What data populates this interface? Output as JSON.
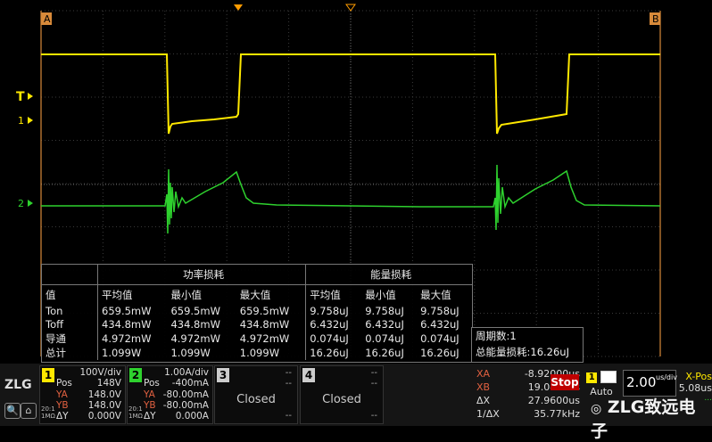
{
  "markers": {
    "a": "A",
    "b": "B",
    "trigger": "T",
    "ch1": "1",
    "ch2": "2"
  },
  "measurements": {
    "group1_title": "功率损耗",
    "group2_title": "能量损耗",
    "col_value": "值",
    "columns": [
      "平均值",
      "最小值",
      "最大值",
      "平均值",
      "最小值",
      "最大值"
    ],
    "rows": [
      {
        "label": "Ton",
        "values": [
          "659.5mW",
          "659.5mW",
          "659.5mW",
          "9.758uJ",
          "9.758uJ",
          "9.758uJ"
        ]
      },
      {
        "label": "Toff",
        "values": [
          "434.8mW",
          "434.8mW",
          "434.8mW",
          "6.432uJ",
          "6.432uJ",
          "6.432uJ"
        ]
      },
      {
        "label": "导通",
        "values": [
          "4.972mW",
          "4.972mW",
          "4.972mW",
          "0.074uJ",
          "0.074uJ",
          "0.074uJ"
        ]
      },
      {
        "label": "总计",
        "values": [
          "1.099W",
          "1.099W",
          "1.099W",
          "16.26uJ",
          "16.26uJ",
          "16.26uJ"
        ]
      }
    ]
  },
  "period": {
    "count": "周期数:1",
    "total_energy": "总能量损耗:16.26uJ"
  },
  "status_bar": {
    "logo": "ZLG",
    "ch1": {
      "num": "1",
      "scale": "100V/div",
      "pos_label": "Pos",
      "pos": "148V",
      "ya_label": "YA",
      "ya": "148.0V",
      "yb_label": "YB",
      "yb": "148.0V",
      "dy_label": "ΔY",
      "dy": "0.000V",
      "imp": "1MΩ",
      "bw": "20:1",
      "color": "#ffe800"
    },
    "ch2": {
      "num": "2",
      "scale": "1.00A/div",
      "pos_label": "Pos",
      "pos": "-400mA",
      "ya_label": "YA",
      "ya": "-80.00mA",
      "yb_label": "YB",
      "yb": "-80.00mA",
      "dy_label": "ΔY",
      "dy": "0.000A",
      "imp": "1MΩ",
      "bw": "20:1",
      "color": "#2ed12e"
    },
    "ch3": {
      "num": "3",
      "state": "Closed",
      "dash": "--"
    },
    "ch4": {
      "num": "4",
      "state": "Closed",
      "dash": "--"
    },
    "cursors": {
      "xa_label": "XA",
      "xa": "-8.92000us",
      "xb_label": "XB",
      "xb": "19.0400us",
      "dx_label": "ΔX",
      "dx": "27.9600us",
      "inv_label": "1/ΔX",
      "inv": "35.77kHz"
    },
    "run_state": "Stop",
    "trigger_mode": "Auto",
    "trigger_source": "1",
    "timebase": "2.00",
    "timebase_unit": "us/div",
    "xpos_label": "X-Pos",
    "xpos": "5.08us",
    "sample_rate": "...",
    "watermark": "ZLG致远电子"
  }
}
